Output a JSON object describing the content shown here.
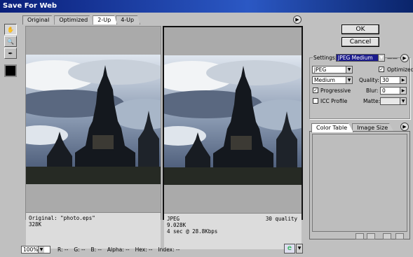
{
  "window": {
    "title": "Save For Web"
  },
  "tabs": [
    {
      "label": "Original"
    },
    {
      "label": "Optimized"
    },
    {
      "label": "2-Up"
    },
    {
      "label": "4-Up"
    }
  ],
  "active_tab": "2-Up",
  "panels": {
    "left": {
      "line1": "Original: \"photo.eps\"",
      "line2": "328K"
    },
    "right": {
      "line1": "JPEG",
      "line2": "9.028K",
      "line3": "4 sec @ 28.8Kbps",
      "quality_note": "30 quality"
    }
  },
  "buttons": {
    "ok": "OK",
    "cancel": "Cancel"
  },
  "settings": {
    "label": "Settings:",
    "preset": "JPEG Medium",
    "format": "JPEG",
    "quality_preset": "Medium",
    "optimized_label": "Optimized",
    "optimized": true,
    "progressive_label": "Progressive",
    "progressive": true,
    "icc_label": "ICC Profile",
    "icc": false,
    "quality_label": "Quality:",
    "quality_value": "30",
    "blur_label": "Blur:",
    "blur_value": "0",
    "matte_label": "Matte:",
    "matte_value": ""
  },
  "right_tabs": [
    {
      "label": "Color Table"
    },
    {
      "label": "Image Size"
    }
  ],
  "statusbar": {
    "zoom": "100%",
    "r": "R: --",
    "g": "G: --",
    "b": "B: --",
    "alpha": "Alpha: --",
    "hex": "Hex: --",
    "index": "Index: --"
  }
}
